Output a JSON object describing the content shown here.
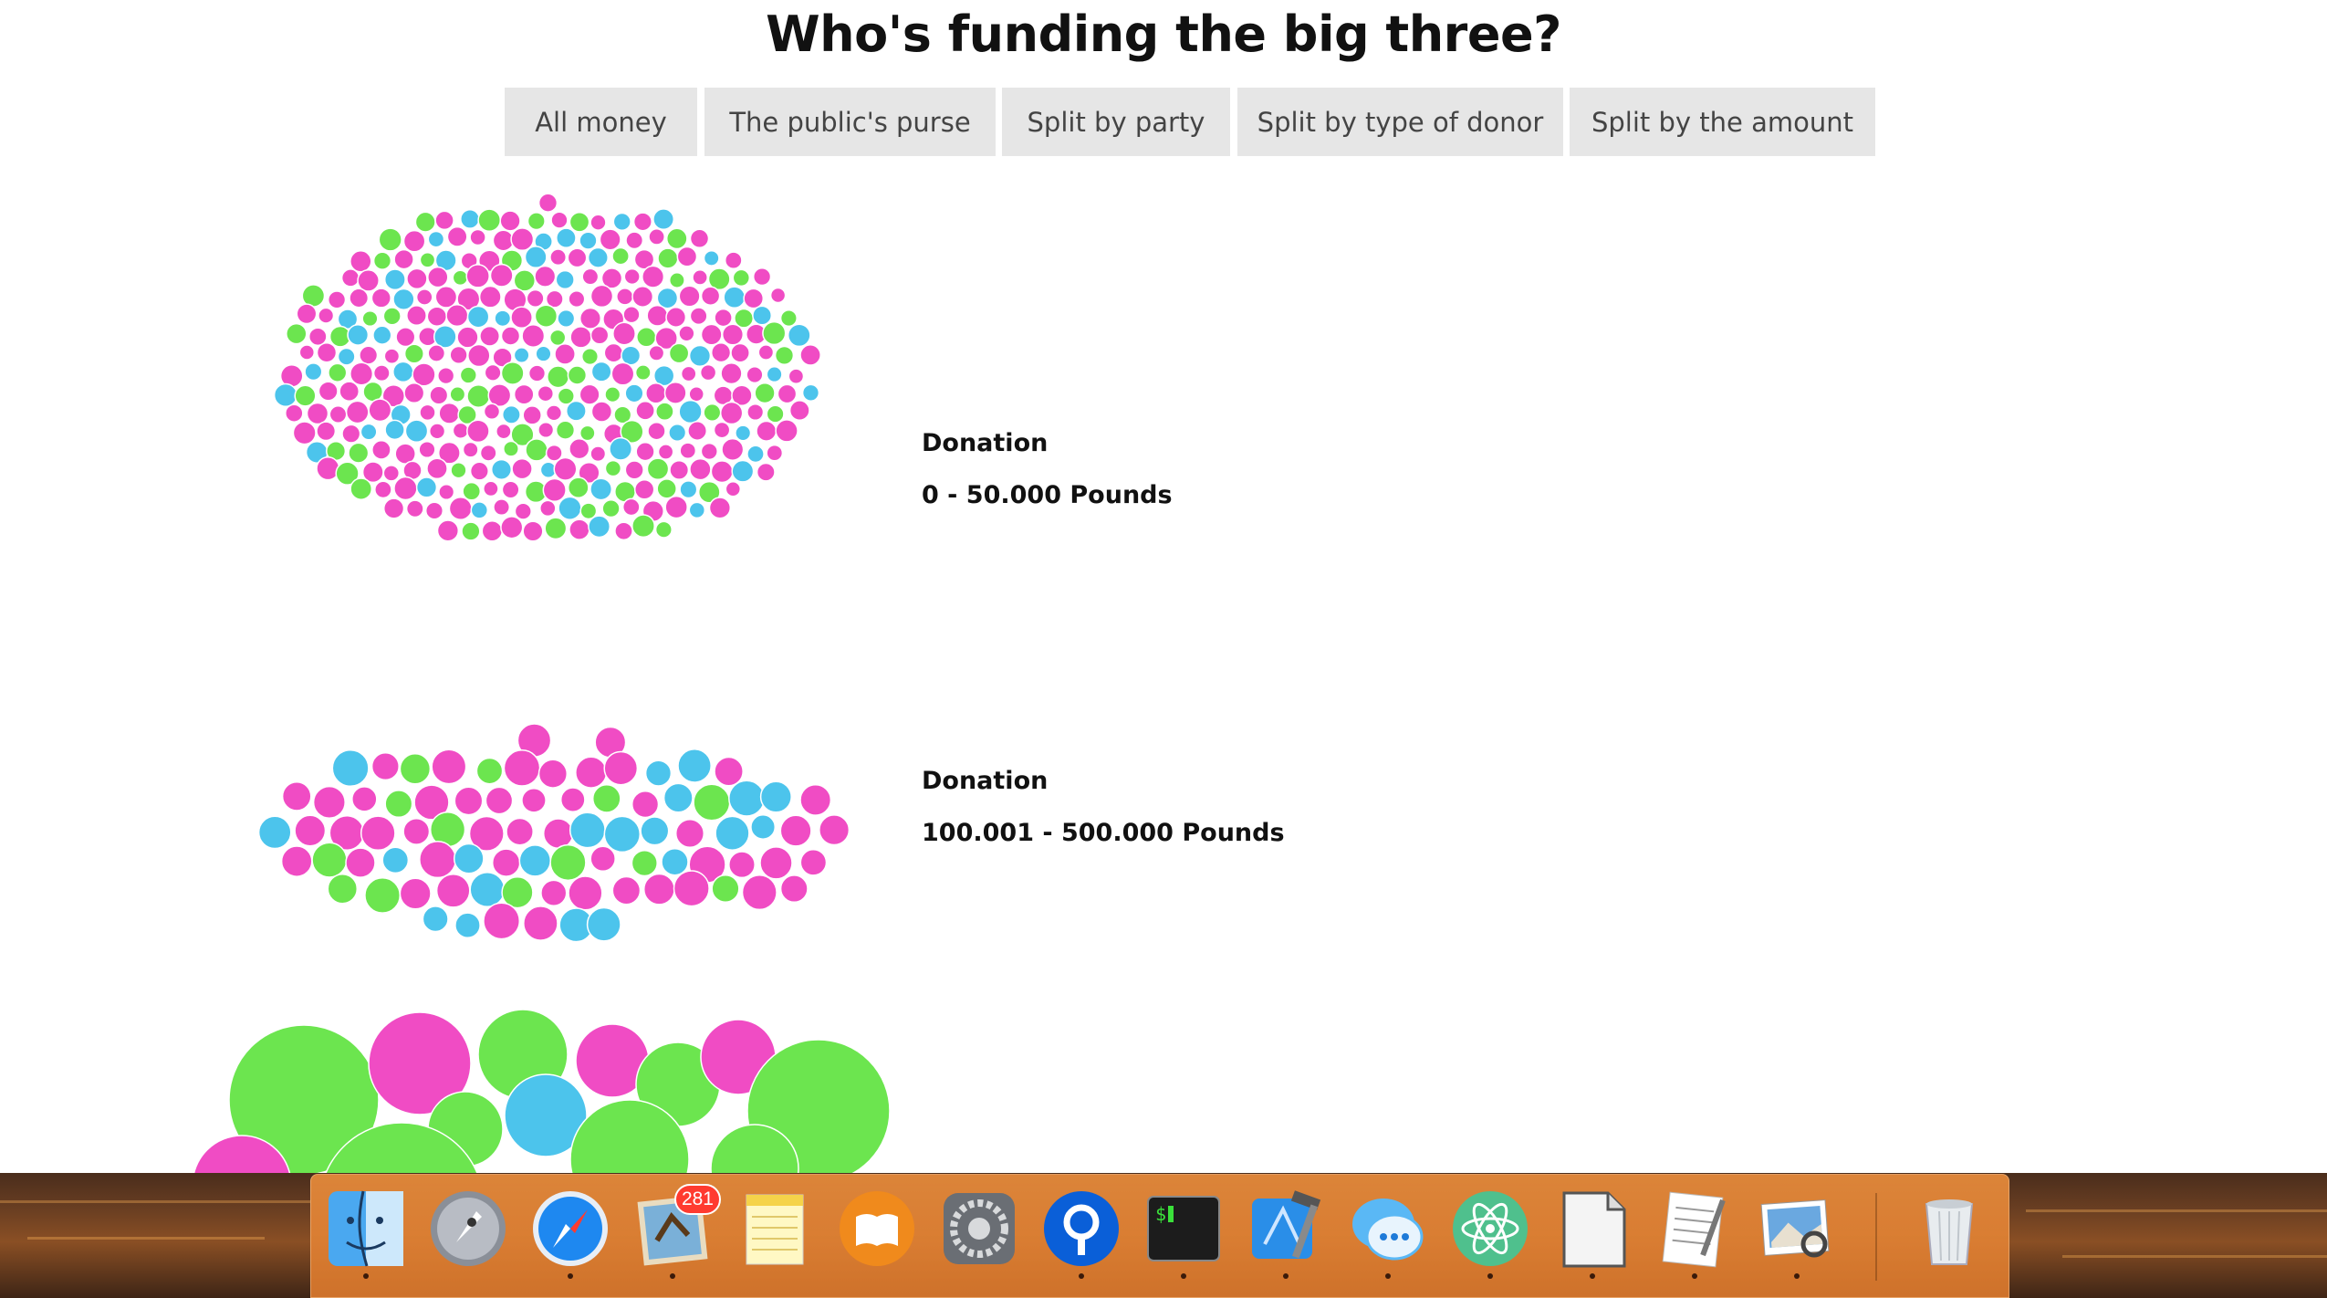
{
  "title": "Who's funding the big three?",
  "tabs": [
    {
      "label": "All money"
    },
    {
      "label": "The public's purse"
    },
    {
      "label": "Split by party"
    },
    {
      "label": "Split by type of donor"
    },
    {
      "label": "Split by the amount"
    }
  ],
  "groups": [
    {
      "label": "Donation",
      "range": "0 - 50.000 Pounds"
    },
    {
      "label": "Donation",
      "range": "100.001 - 500.000 Pounds"
    }
  ],
  "colors": {
    "magenta": "#f04cc4",
    "green": "#6ce54f",
    "blue": "#4cc4ec",
    "tab_bg": "#e6e6e6"
  },
  "dock": {
    "items": [
      {
        "name": "finder-icon",
        "running": true
      },
      {
        "name": "launchpad-icon",
        "running": false
      },
      {
        "name": "safari-icon",
        "running": true
      },
      {
        "name": "mail-icon",
        "running": true,
        "badge": "281"
      },
      {
        "name": "notes-icon",
        "running": false
      },
      {
        "name": "ibooks-icon",
        "running": false
      },
      {
        "name": "system-preferences-icon",
        "running": false
      },
      {
        "name": "sourcetree-icon",
        "running": true
      },
      {
        "name": "terminal-icon",
        "running": true
      },
      {
        "name": "xcode-icon",
        "running": true
      },
      {
        "name": "messages-icon",
        "running": true
      },
      {
        "name": "atom-icon",
        "running": true
      },
      {
        "name": "blank-document-icon",
        "running": true
      },
      {
        "name": "textedit-icon",
        "running": true
      },
      {
        "name": "preview-icon",
        "running": true
      },
      {
        "name": "trash-icon",
        "running": false
      }
    ],
    "terminal_prompt": "$"
  }
}
